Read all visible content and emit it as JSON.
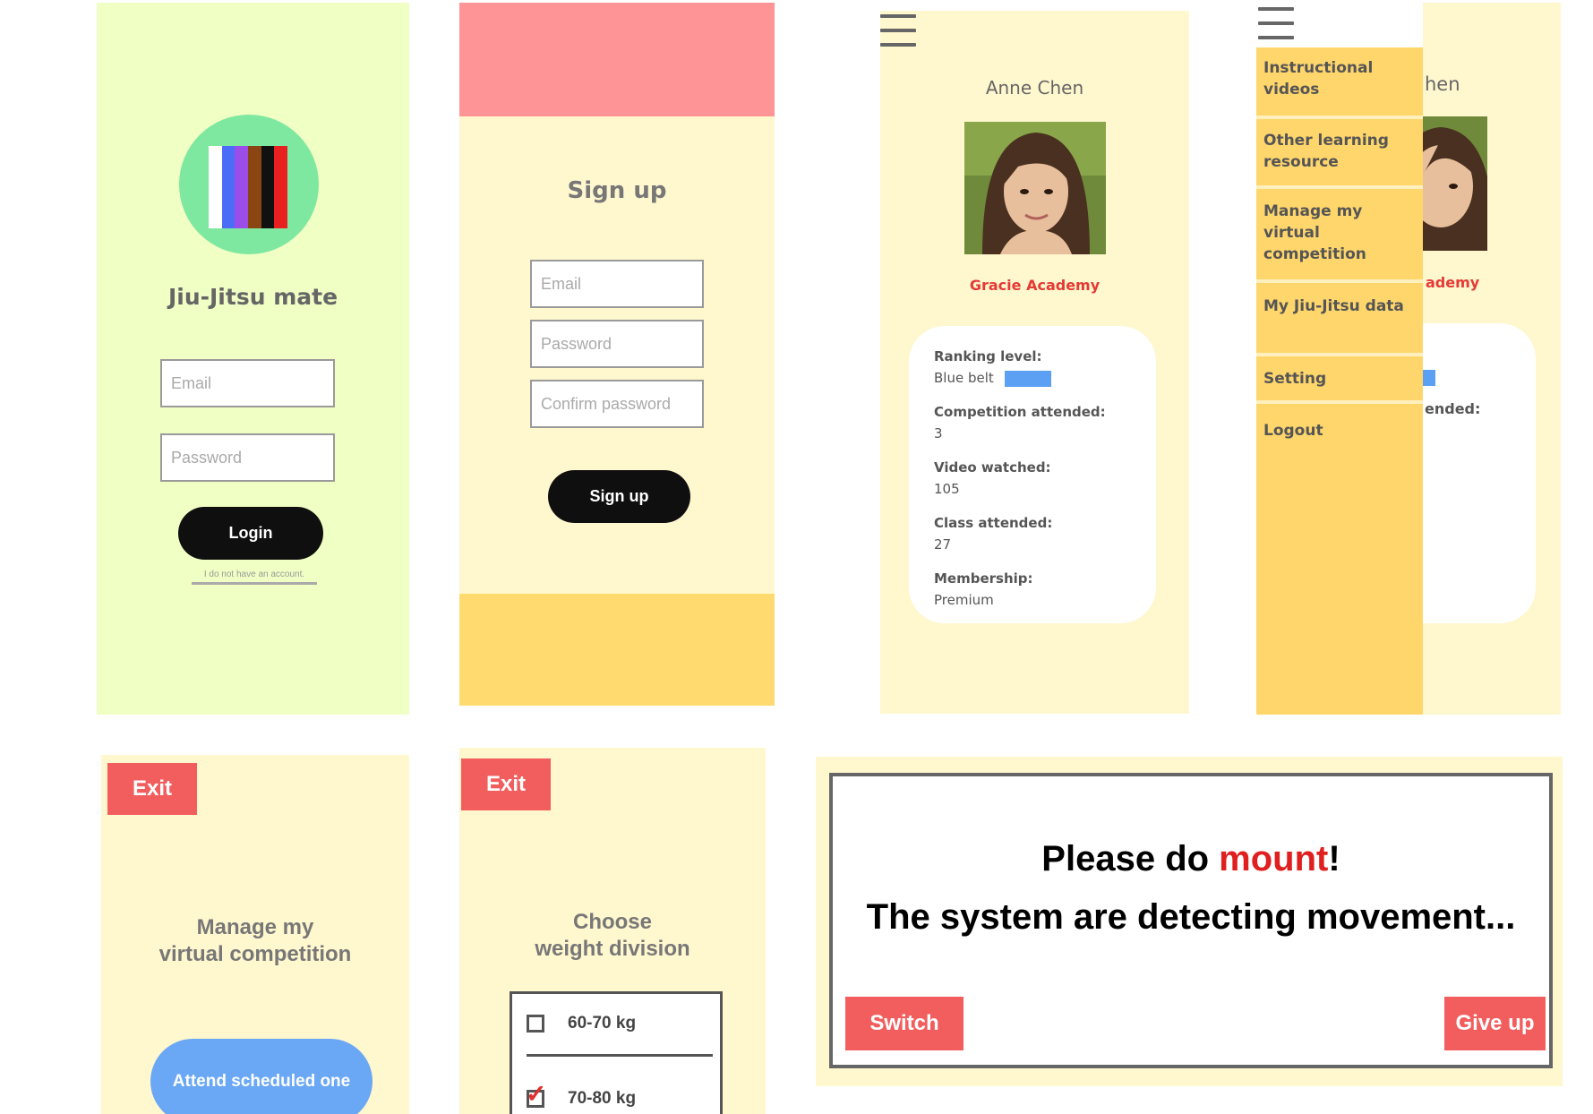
{
  "login": {
    "belt_colors": [
      "#ffffff",
      "#4a6cf7",
      "#9a4de8",
      "#8b4513",
      "#111111",
      "#e82020"
    ],
    "app_title": "Jiu-Jitsu mate",
    "email_placeholder": "Email",
    "password_placeholder": "Password",
    "login_label": "Login",
    "no_account_link": "I do not have an account."
  },
  "signup": {
    "title": "Sign up",
    "email_placeholder": "Email",
    "password_placeholder": "Password",
    "confirm_placeholder": "Confirm password",
    "signup_label": "Sign up"
  },
  "profile": {
    "name": "Anne Chen",
    "academy": "Gracie Academy",
    "stats": {
      "ranking_label": "Ranking level:",
      "ranking_value": "Blue belt",
      "competition_label": "Competition attended:",
      "competition_value": "3",
      "video_label": "Video watched:",
      "video_value": "105",
      "class_label": "Class attended:",
      "class_value": "27",
      "membership_label": "Membership:",
      "membership_value": "Premium"
    }
  },
  "menu": {
    "items": [
      {
        "label": "Instructional videos"
      },
      {
        "label": "Other learning resource"
      },
      {
        "label": "Manage my virtual competition"
      },
      {
        "label": "My Jiu-Jitsu data"
      },
      {
        "label": "Setting"
      },
      {
        "label": "Logout"
      }
    ],
    "peek_name": "hen",
    "peek_academy": "ademy",
    "peek_stat": "ended:"
  },
  "competition": {
    "exit_label": "Exit",
    "title_line1": "Manage my",
    "title_line2": "virtual competition",
    "attend_label": "Attend scheduled one"
  },
  "weight": {
    "exit_label": "Exit",
    "title_line1": "Choose",
    "title_line2": "weight division",
    "options": [
      {
        "label": "60-70 kg",
        "checked": false
      },
      {
        "label": "70-80 kg",
        "checked": true
      }
    ]
  },
  "detect": {
    "line1_prefix": "Please do ",
    "line1_highlight": "mount",
    "line1_suffix": "!",
    "line2": "The system are detecting movement...",
    "switch_label": "Switch",
    "giveup_label": "Give up"
  },
  "colors": {
    "accent_red": "#f25e5e",
    "accent_blue": "#6aa7f5",
    "cream": "#fff7ce",
    "menu_yellow": "#ffd66b"
  }
}
